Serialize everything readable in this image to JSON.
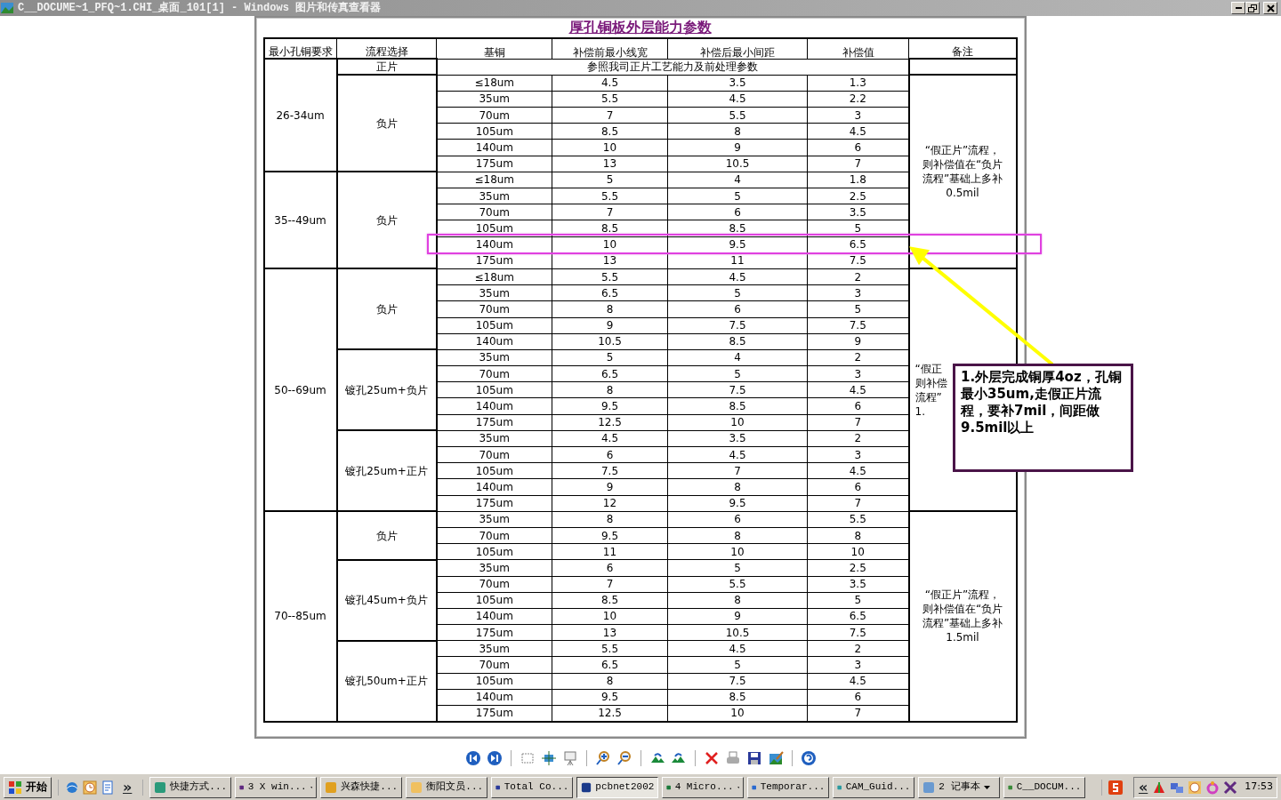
{
  "window": {
    "title": "C__DOCUME~1_PFQ~1.CHI_桌面_101[1] - Windows 图片和传真查看器"
  },
  "document": {
    "title": "厚孔铜板外层能力参数",
    "columns": [
      "最小孔铜要求",
      "流程选择",
      "基铜",
      "补偿前最小线宽",
      "补偿后最小间距",
      "补偿值",
      "备注"
    ],
    "sections": [
      {
        "remark": {
          "lines": [
            "“假正片”流程，",
            "则补偿值在“负片",
            "流程”基础上多补",
            "0.5mil"
          ],
          "clipped": false
        },
        "groups": [
          {
            "requirement": "26-34um",
            "flows": [
              {
                "name": "正片",
                "kind": "note",
                "note": "参照我司正片工艺能力及前处理参数"
              },
              {
                "name": "负片",
                "kind": "rows",
                "rows": [
                  {
                    "cells": [
                      "≤18um",
                      "4.5",
                      "3.5",
                      "1.3"
                    ],
                    "marked": false
                  },
                  {
                    "cells": [
                      "35um",
                      "5.5",
                      "4.5",
                      "2.2"
                    ],
                    "marked": false
                  },
                  {
                    "cells": [
                      "70um",
                      "7",
                      "5.5",
                      "3"
                    ],
                    "marked": false
                  },
                  {
                    "cells": [
                      "105um",
                      "8.5",
                      "8",
                      "4.5"
                    ],
                    "marked": false
                  },
                  {
                    "cells": [
                      "140um",
                      "10",
                      "9",
                      "6"
                    ],
                    "marked": false
                  },
                  {
                    "cells": [
                      "175um",
                      "13",
                      "10.5",
                      "7"
                    ],
                    "marked": false
                  }
                ]
              }
            ]
          },
          {
            "requirement": "35--49um",
            "flows": [
              {
                "name": "负片",
                "kind": "rows",
                "rows": [
                  {
                    "cells": [
                      "≤18um",
                      "5",
                      "4",
                      "1.8"
                    ],
                    "marked": false
                  },
                  {
                    "cells": [
                      "35um",
                      "5.5",
                      "5",
                      "2.5"
                    ],
                    "marked": false
                  },
                  {
                    "cells": [
                      "70um",
                      "7",
                      "6",
                      "3.5"
                    ],
                    "marked": false
                  },
                  {
                    "cells": [
                      "105um",
                      "8.5",
                      "8.5",
                      "5"
                    ],
                    "marked": false
                  },
                  {
                    "cells": [
                      "140um",
                      "10",
                      "9.5",
                      "6.5"
                    ],
                    "marked": true
                  },
                  {
                    "cells": [
                      "175um",
                      "13",
                      "11",
                      "7.5"
                    ],
                    "marked": false
                  }
                ]
              }
            ]
          }
        ]
      },
      {
        "remark": {
          "lines": [
            "“假正",
            "则补偿",
            "流程”",
            "1."
          ],
          "clipped": true
        },
        "groups": [
          {
            "requirement": "50--69um",
            "flows": [
              {
                "name": "负片",
                "kind": "rows",
                "rows": [
                  {
                    "cells": [
                      "≤18um",
                      "5.5",
                      "4.5",
                      "2"
                    ],
                    "marked": false
                  },
                  {
                    "cells": [
                      "35um",
                      "6.5",
                      "5",
                      "3"
                    ],
                    "marked": false
                  },
                  {
                    "cells": [
                      "70um",
                      "8",
                      "6",
                      "5"
                    ],
                    "marked": false
                  },
                  {
                    "cells": [
                      "105um",
                      "9",
                      "7.5",
                      "7.5"
                    ],
                    "marked": false
                  },
                  {
                    "cells": [
                      "140um",
                      "10.5",
                      "8.5",
                      "9"
                    ],
                    "marked": false
                  }
                ]
              },
              {
                "name": "镀孔25um+负片",
                "kind": "rows",
                "rows": [
                  {
                    "cells": [
                      "35um",
                      "5",
                      "4",
                      "2"
                    ],
                    "marked": false
                  },
                  {
                    "cells": [
                      "70um",
                      "6.5",
                      "5",
                      "3"
                    ],
                    "marked": false
                  },
                  {
                    "cells": [
                      "105um",
                      "8",
                      "7.5",
                      "4.5"
                    ],
                    "marked": false
                  },
                  {
                    "cells": [
                      "140um",
                      "9.5",
                      "8.5",
                      "6"
                    ],
                    "marked": false
                  },
                  {
                    "cells": [
                      "175um",
                      "12.5",
                      "10",
                      "7"
                    ],
                    "marked": false
                  }
                ]
              },
              {
                "name": "镀孔25um+正片",
                "kind": "rows",
                "rows": [
                  {
                    "cells": [
                      "35um",
                      "4.5",
                      "3.5",
                      "2"
                    ],
                    "marked": false
                  },
                  {
                    "cells": [
                      "70um",
                      "6",
                      "4.5",
                      "3"
                    ],
                    "marked": false
                  },
                  {
                    "cells": [
                      "105um",
                      "7.5",
                      "7",
                      "4.5"
                    ],
                    "marked": false
                  },
                  {
                    "cells": [
                      "140um",
                      "9",
                      "8",
                      "6"
                    ],
                    "marked": false
                  },
                  {
                    "cells": [
                      "175um",
                      "12",
                      "9.5",
                      "7"
                    ],
                    "marked": false
                  }
                ]
              }
            ]
          }
        ]
      },
      {
        "remark": {
          "lines": [
            "“假正片”流程，",
            "则补偿值在“负片",
            "流程”基础上多补",
            "1.5mil"
          ],
          "clipped": false
        },
        "groups": [
          {
            "requirement": "70--85um",
            "flows": [
              {
                "name": "负片",
                "kind": "rows",
                "rows": [
                  {
                    "cells": [
                      "35um",
                      "8",
                      "6",
                      "5.5"
                    ],
                    "marked": false
                  },
                  {
                    "cells": [
                      "70um",
                      "9.5",
                      "8",
                      "8"
                    ],
                    "marked": false
                  },
                  {
                    "cells": [
                      "105um",
                      "11",
                      "10",
                      "10"
                    ],
                    "marked": false
                  }
                ]
              },
              {
                "name": "镀孔45um+负片",
                "kind": "rows",
                "rows": [
                  {
                    "cells": [
                      "35um",
                      "6",
                      "5",
                      "2.5"
                    ],
                    "marked": false
                  },
                  {
                    "cells": [
                      "70um",
                      "7",
                      "5.5",
                      "3.5"
                    ],
                    "marked": false
                  },
                  {
                    "cells": [
                      "105um",
                      "8.5",
                      "8",
                      "5"
                    ],
                    "marked": false
                  },
                  {
                    "cells": [
                      "140um",
                      "10",
                      "9",
                      "6.5"
                    ],
                    "marked": false
                  },
                  {
                    "cells": [
                      "175um",
                      "13",
                      "10.5",
                      "7.5"
                    ],
                    "marked": false
                  }
                ]
              },
              {
                "name": "镀孔50um+正片",
                "kind": "rows",
                "rows": [
                  {
                    "cells": [
                      "35um",
                      "5.5",
                      "4.5",
                      "2"
                    ],
                    "marked": false
                  },
                  {
                    "cells": [
                      "70um",
                      "6.5",
                      "5",
                      "3"
                    ],
                    "marked": false
                  },
                  {
                    "cells": [
                      "105um",
                      "8",
                      "7.5",
                      "4.5"
                    ],
                    "marked": false
                  },
                  {
                    "cells": [
                      "140um",
                      "9.5",
                      "8.5",
                      "6"
                    ],
                    "marked": false
                  },
                  {
                    "cells": [
                      "175um",
                      "12.5",
                      "10",
                      "7"
                    ],
                    "marked": false
                  }
                ]
              }
            ]
          }
        ]
      }
    ]
  },
  "callout": {
    "text": "1.外层完成铜厚4oz，孔铜最小35um,走假正片流程，要补7mil，间距做9.5mil以上"
  },
  "taskbar": {
    "start": "开始",
    "quick_launch_more": "»",
    "tasks": [
      {
        "label": "快捷方式...",
        "selected": false
      },
      {
        "label": "X win...",
        "count": "3",
        "selected": false
      },
      {
        "label": "兴森快捷...",
        "selected": false
      },
      {
        "label": "衡阳文员...",
        "selected": false
      },
      {
        "label": "Total Co...",
        "selected": false
      },
      {
        "label": "pcbnet2002",
        "selected": true
      },
      {
        "label": "Micro...",
        "count": "4",
        "selected": false
      },
      {
        "label": "Temporar...",
        "selected": false
      },
      {
        "label": "CAM_Guid...",
        "selected": false
      },
      {
        "label": "记事本",
        "count": "2",
        "selected": false
      },
      {
        "label": "C__DOCUM...",
        "selected": false
      }
    ],
    "tray": {
      "expand": "«",
      "time": "17:53"
    }
  }
}
